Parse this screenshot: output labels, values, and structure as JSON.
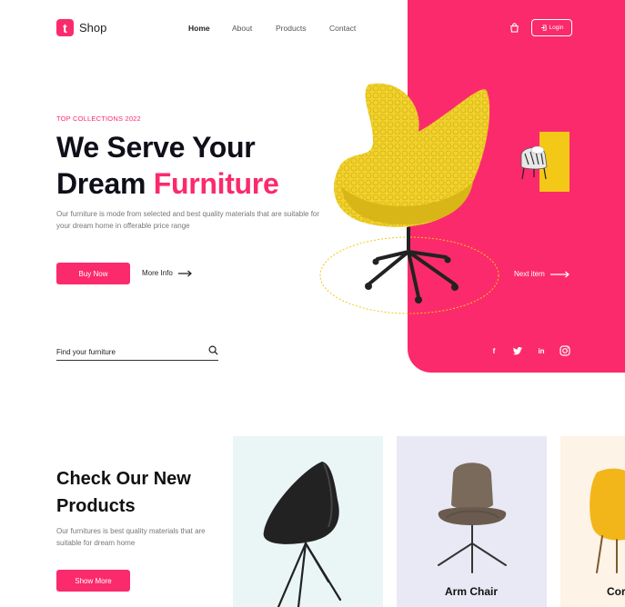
{
  "brand": {
    "mark": "t",
    "name": "Shop"
  },
  "nav": {
    "items": [
      "Home",
      "About",
      "Products",
      "Contact"
    ],
    "active": "Home"
  },
  "header": {
    "login_label": "Login"
  },
  "hero": {
    "eyebrow": "TOP COLLECTIONS 2022",
    "title_line1": "We Serve Your",
    "title_line2_a": "Dream ",
    "title_line2_b": "Furniture",
    "description": "Our furniture is mode from selected and best quality materials that are suitable for your dream home in offerable price range",
    "buy_label": "Buy Now",
    "more_label": "More Info",
    "next_label": "Next item"
  },
  "search": {
    "placeholder": "Find your furniture"
  },
  "social": {
    "icons": [
      "facebook-icon",
      "twitter-icon",
      "linkedin-icon",
      "instagram-icon"
    ]
  },
  "products": {
    "title": "Check Our New Products",
    "description": "Our furnitures is best quality materials that are suitable for dream home",
    "button_label": "Show More",
    "cards": [
      {
        "label": ""
      },
      {
        "label": "Arm Chair"
      },
      {
        "label": "Cor"
      }
    ]
  },
  "colors": {
    "accent": "#fb2a6c",
    "yellow": "#f4c817",
    "ink": "#0f0f1a"
  }
}
